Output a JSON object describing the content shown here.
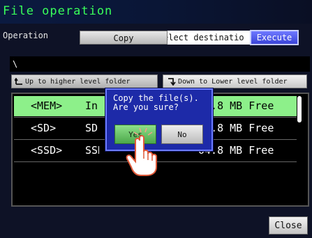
{
  "title": "File operation",
  "operation": {
    "label": "Operation",
    "mode_button": "Copy",
    "destination_text": "elect destinatio",
    "execute_button": "Execute"
  },
  "path": "\\",
  "nav": {
    "up_label": "Up to higher level folder",
    "down_label": "Down to Lower level folder",
    "up_icon": "up-folder-icon",
    "down_icon": "down-folder-icon"
  },
  "devices": [
    {
      "name": "<MEM>",
      "kind": "In",
      "free": "04.8 MB Free",
      "selected": true
    },
    {
      "name": "<SD>",
      "kind": "SD",
      "free": "04.8 MB Free",
      "selected": false
    },
    {
      "name": "<SSD>",
      "kind": "SSD",
      "free": "04.8 MB Free",
      "selected": false
    }
  ],
  "dialog": {
    "line1": "Copy the file(s).",
    "line2": "Are you sure?",
    "yes": "Yes",
    "no": "No"
  },
  "close_button": "Close",
  "colors": {
    "title_text": "#39ff5a",
    "selected_row": "#8df08a",
    "execute": "#4a55f0",
    "dialog_bg": "#1d2aa8"
  }
}
